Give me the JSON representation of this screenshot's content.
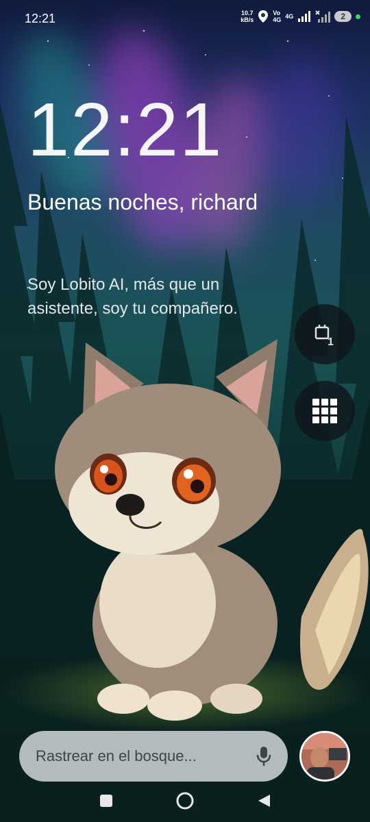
{
  "status_bar": {
    "time": "12:21",
    "speed_value": "10.7",
    "speed_unit": "kB/s",
    "network1_top": "Vo",
    "network1_bottom": "4G",
    "network2_top": "4G",
    "sim_badge": "2",
    "icons": [
      "location-pin-icon",
      "signal-strength-icon",
      "no-signal-icon",
      "active-dot-icon"
    ]
  },
  "lock_screen": {
    "clock": "12:21",
    "greeting": "Buenas noches, richard",
    "assistant_message": "Soy Lobito AI, más que un asistente, soy tu compañero."
  },
  "quick_actions": {
    "calendar_badge": "1",
    "calendar_icon": "calendar-icon",
    "apps_icon": "apps-grid-icon"
  },
  "search": {
    "placeholder": "Rastrear en el bosque...",
    "mic_icon": "microphone-icon"
  },
  "navigation": {
    "icons": [
      "recents-square-icon",
      "home-circle-icon",
      "back-triangle-icon"
    ]
  },
  "colors": {
    "aurora_pink": "#d35bd2",
    "aurora_teal": "#2ac7b2",
    "fab_background": "#0f161c",
    "status_active": "#3ddc57"
  }
}
